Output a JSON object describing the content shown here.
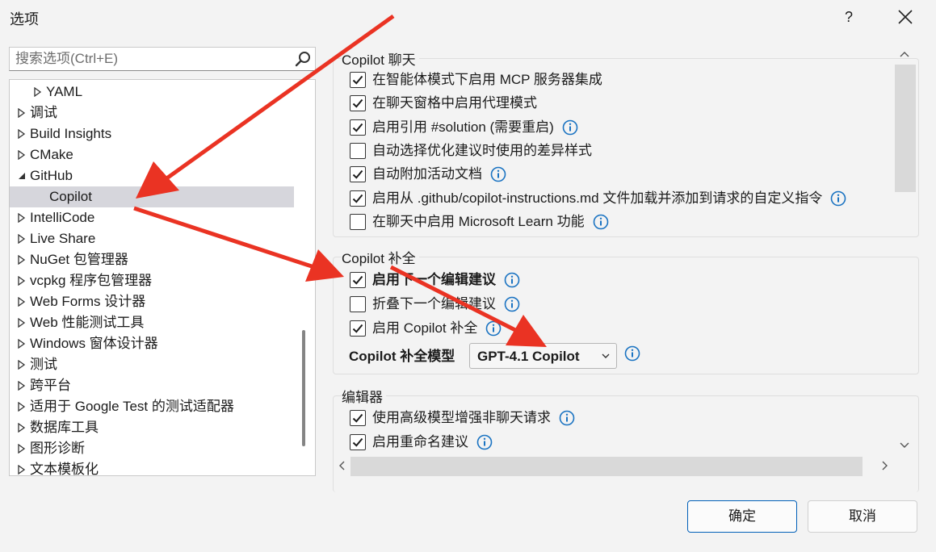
{
  "window": {
    "title": "选项",
    "help_label": "?",
    "close_icon": "close-icon"
  },
  "search": {
    "placeholder": "搜索选项(Ctrl+E)",
    "value": "",
    "icon": "search-icon"
  },
  "tree": {
    "items": [
      {
        "label": "YAML",
        "state": "collapsed",
        "indent": 1
      },
      {
        "label": "调试",
        "state": "collapsed",
        "indent": 0
      },
      {
        "label": "Build Insights",
        "state": "collapsed",
        "indent": 0
      },
      {
        "label": "CMake",
        "state": "collapsed",
        "indent": 0
      },
      {
        "label": "GitHub",
        "state": "expanded",
        "indent": 0
      },
      {
        "label": "Copilot",
        "state": "leaf",
        "indent": 1,
        "selected": true
      },
      {
        "label": "IntelliCode",
        "state": "collapsed",
        "indent": 0
      },
      {
        "label": "Live Share",
        "state": "collapsed",
        "indent": 0
      },
      {
        "label": "NuGet 包管理器",
        "state": "collapsed",
        "indent": 0
      },
      {
        "label": "vcpkg 程序包管理器",
        "state": "collapsed",
        "indent": 0
      },
      {
        "label": "Web Forms 设计器",
        "state": "collapsed",
        "indent": 0
      },
      {
        "label": "Web 性能测试工具",
        "state": "collapsed",
        "indent": 0
      },
      {
        "label": "Windows 窗体设计器",
        "state": "collapsed",
        "indent": 0
      },
      {
        "label": "测试",
        "state": "collapsed",
        "indent": 0
      },
      {
        "label": "跨平台",
        "state": "collapsed",
        "indent": 0
      },
      {
        "label": "适用于 Google Test 的测试适配器",
        "state": "collapsed",
        "indent": 0
      },
      {
        "label": "数据库工具",
        "state": "collapsed",
        "indent": 0
      },
      {
        "label": "图形诊断",
        "state": "collapsed",
        "indent": 0
      },
      {
        "label": "文本模板化",
        "state": "collapsed",
        "indent": 0
      }
    ]
  },
  "chat": {
    "title": "Copilot 聊天",
    "options": [
      {
        "label": "在智能体模式下启用 MCP 服务器集成",
        "checked": true,
        "info": false
      },
      {
        "label": "在聊天窗格中启用代理模式",
        "checked": true,
        "info": false
      },
      {
        "label": "启用引用 #solution (需要重启)",
        "checked": true,
        "info": true
      },
      {
        "label": "自动选择优化建议时使用的差异样式",
        "checked": false,
        "info": false
      },
      {
        "label": "自动附加活动文档",
        "checked": true,
        "info": true
      },
      {
        "label": "启用从 .github/copilot-instructions.md 文件加载并添加到请求的自定义指令",
        "checked": true,
        "info": true
      },
      {
        "label": "在聊天中启用 Microsoft Learn 功能",
        "checked": false,
        "info": true
      }
    ]
  },
  "completion": {
    "title": "Copilot 补全",
    "options": [
      {
        "label": "启用下一个编辑建议",
        "checked": true,
        "info": true,
        "bold": true
      },
      {
        "label": "折叠下一个编辑建议",
        "checked": false,
        "info": true
      },
      {
        "label": "启用 Copilot 补全",
        "checked": true,
        "info": true
      }
    ],
    "model_label": "Copilot 补全模型",
    "model_value": "GPT-4.1 Copilot"
  },
  "editor": {
    "title": "编辑器",
    "options": [
      {
        "label": "使用高级模型增强非聊天请求",
        "checked": true,
        "info": true
      },
      {
        "label": "启用重命名建议",
        "checked": true,
        "info": true
      }
    ]
  },
  "buttons": {
    "ok": "确定",
    "cancel": "取消"
  },
  "colors": {
    "info_blue": "#1a73c2",
    "accent_border": "#005fb8",
    "annotation_red": "#ea3323",
    "selected_bg": "#d6d6dc"
  }
}
